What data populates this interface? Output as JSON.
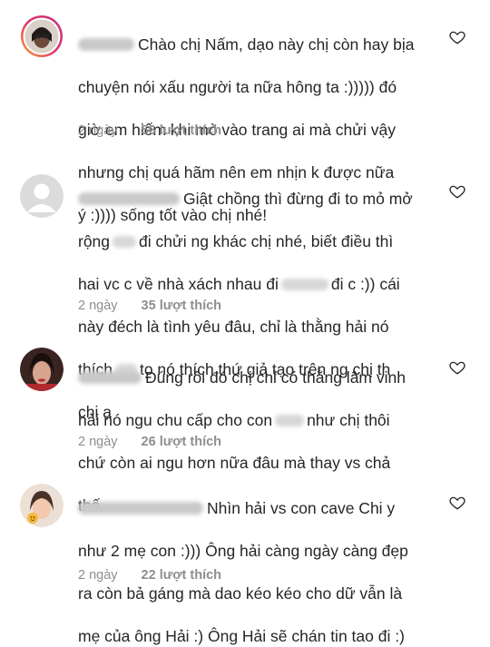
{
  "comments": [
    {
      "lines": [
        "Chào chị Nấm, dạo này chị còn hay bịa",
        "chuyện nói xấu người ta nữa hông ta :))))) đó",
        "giờ em hiếm khi mò vào trang ai mà chửi vậy",
        "nhưng chị quá hãm nên em nhịn k được nữa",
        "ý :)))) sống tốt vào chị nhé!"
      ],
      "time": "2 ngày",
      "likes": "56 lượt thích"
    },
    {
      "lines": [
        "Giật chồng thì đừng đi to mỏ mở",
        "rộng",
        "đi chửi ng khác chị nhé, biết điều thì",
        "hai vc c về nhà xách nhau đi",
        "đi c :)) cái",
        "này đéch là tình yêu đâu, chỉ là thằng hải nó",
        "thích",
        "to nó thích thứ giả tạo trên ng chị th",
        "chị ạ"
      ],
      "time": "2 ngày",
      "likes": "35 lượt thích"
    },
    {
      "lines": [
        "Đúng rồi đó chị chỉ có thằng lâm vinh",
        "hải nó ngu chu cấp cho con",
        "như chị thôi",
        "chứ còn ai ngu hơn nữa đâu mà thay vs chả",
        "thế"
      ],
      "time": "2 ngày",
      "likes": "26 lượt thích"
    },
    {
      "lines": [
        "Nhìn hải vs con cave Chi y",
        "như 2 mẹ con :))) Ông hải càng ngày càng đẹp",
        "ra còn bả gáng mà dao kéo kéo cho dữ vẫn là",
        "mẹ của ông Hải :) Ông Hải sẽ chán tin tao đi :)"
      ],
      "time": "2 ngày",
      "likes": "22 lượt thích"
    }
  ]
}
